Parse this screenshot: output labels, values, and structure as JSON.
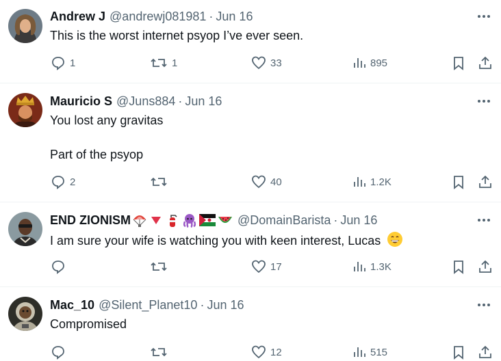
{
  "tweets": [
    {
      "name": "Andrew J",
      "handle": "@andrewj081981",
      "date": "Jun 16",
      "text_lines": [
        "This is the worst internet psyop I’ve ever seen."
      ],
      "replies": "1",
      "reposts": "1",
      "likes": "33",
      "views": "895",
      "avatar": "portrait-long-hair",
      "colors": {
        "bg": "#5a4a3a",
        "accent": "#c9a27a"
      }
    },
    {
      "name": "Mauricio S",
      "handle": "@Juns884",
      "date": "Jun 16",
      "text_lines": [
        "You lost any gravitas",
        "Part of the psyop"
      ],
      "replies": "2",
      "reposts": "",
      "likes": "40",
      "views": "1.2K",
      "avatar": "crowned-warrior",
      "colors": {
        "bg": "#6b2a1a",
        "accent": "#d8a030"
      }
    },
    {
      "name": "END ZIONISM",
      "name_emojis": [
        "parachute-icon",
        "red-triangle-icon",
        "fire-extinguisher-icon",
        "octopus-icon",
        "western-sahara-flag-icon",
        "watermelon-icon"
      ],
      "handle": "@DomainBarista",
      "date": "Jun 16",
      "text_lines": [
        "I am sure your wife is watching you with keen interest, Lucas"
      ],
      "text_emoji": "grinning-face-icon",
      "replies": "",
      "reposts": "",
      "likes": "17",
      "views": "1.3K",
      "avatar": "man-with-glasses",
      "colors": {
        "bg": "#7a8a90",
        "accent": "#3a2a22"
      }
    },
    {
      "name": "Mac_10",
      "handle": "@Silent_Planet10",
      "date": "Jun 16",
      "text_lines": [
        "Compromised"
      ],
      "replies": "",
      "reposts": "",
      "likes": "12",
      "views": "515",
      "avatar": "astronaut-monkey",
      "colors": {
        "bg": "#3a3a32",
        "accent": "#c8c2b0"
      }
    }
  ],
  "separator": "·"
}
